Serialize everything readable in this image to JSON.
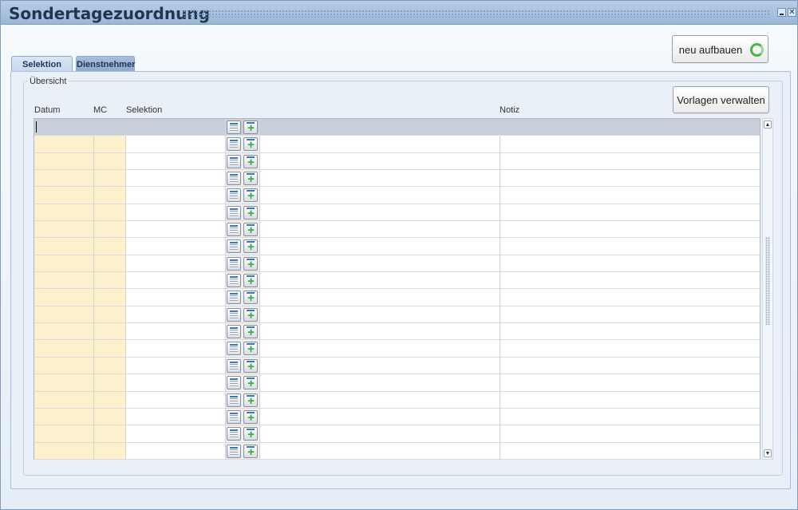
{
  "window": {
    "title": "Sondertagezuordnung",
    "close_glyph": "✕"
  },
  "toolbar": {
    "rebuild_label": "neu aufbauen",
    "templates_label": "Vorlagen verwalten"
  },
  "tabs": [
    {
      "label": "Selektion",
      "active": true
    },
    {
      "label": "Dienstnehmer",
      "active": false
    }
  ],
  "overview": {
    "legend": "Übersicht",
    "columns": {
      "datum": "Datum",
      "mc": "MC",
      "selektion": "Selektion",
      "notiz": "Notiz"
    },
    "row_count": 20,
    "selected_row": 0
  },
  "scrollbar": {
    "up_glyph": "▲",
    "down_glyph": "▼"
  },
  "icons": {
    "row_buttons": [
      "calendar-icon",
      "add-icon"
    ],
    "rebuild": "recycle-icon"
  },
  "colors": {
    "title_bar": "#9bb7d8",
    "date_column_bg": "#fdf0cc",
    "selected_row": "#c7cfdb",
    "add_green": "#2fae3a"
  }
}
